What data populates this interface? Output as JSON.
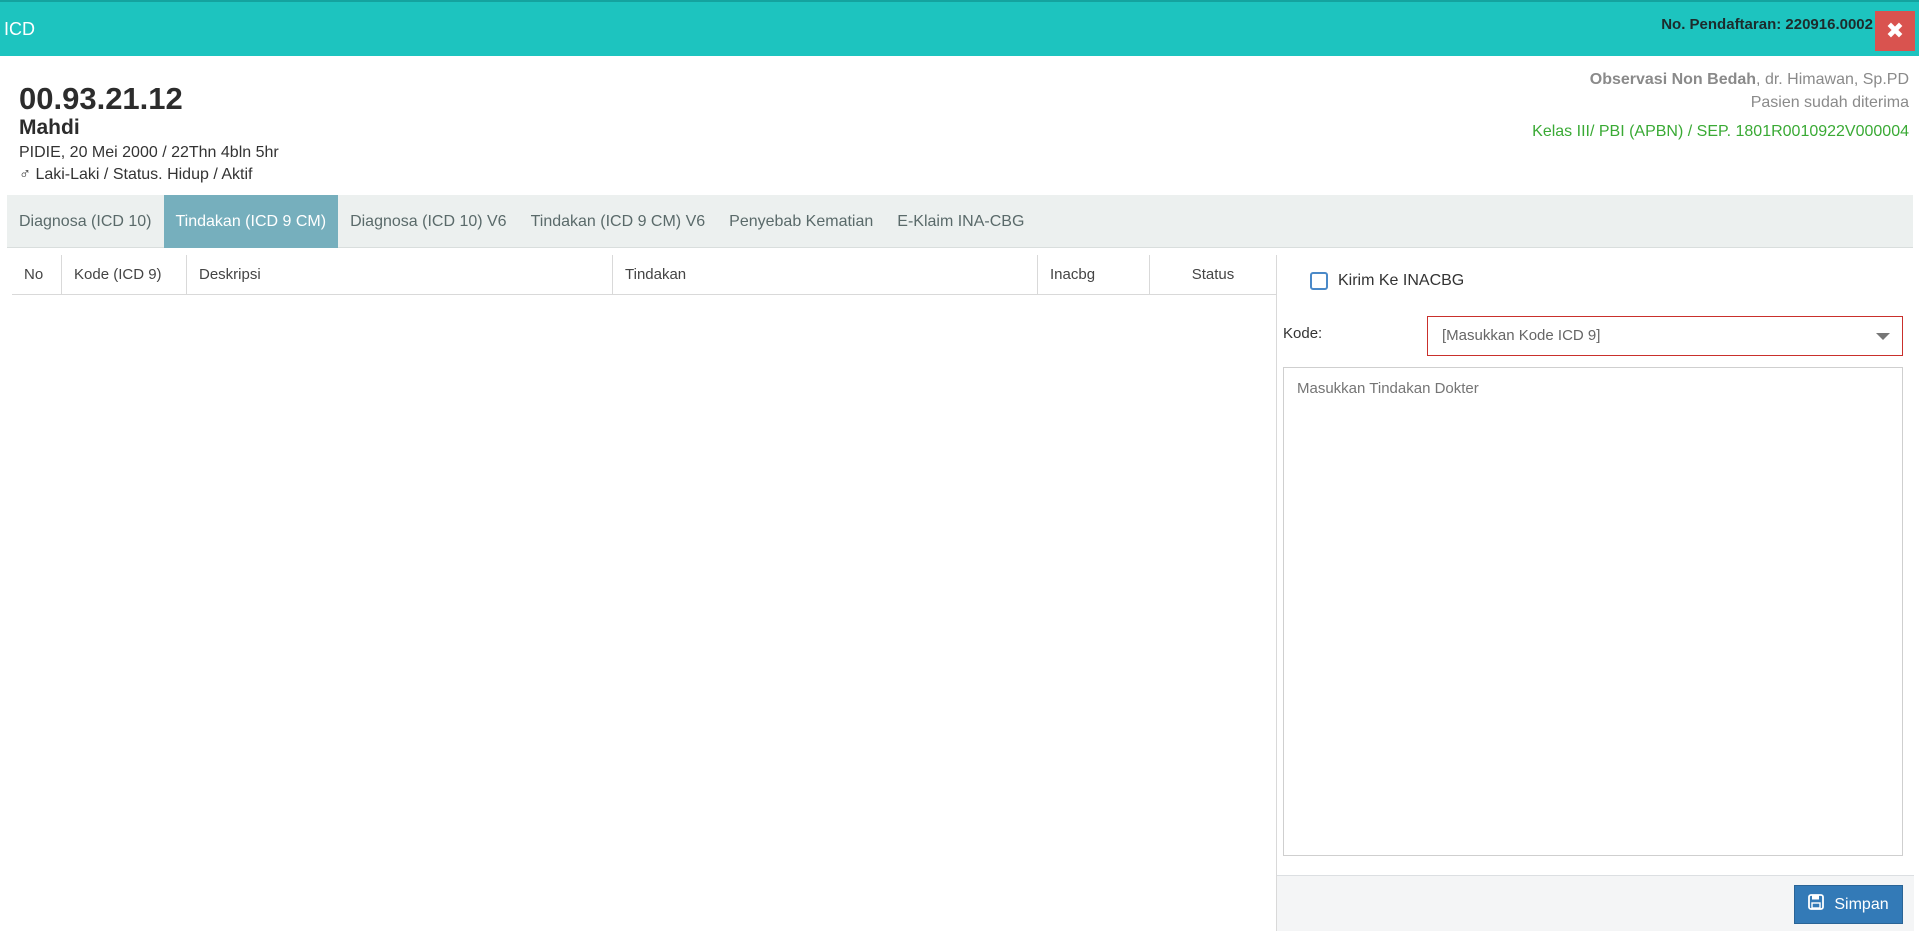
{
  "window": {
    "title": "ICD",
    "registration": "No. Pendaftaran: 220916.0002",
    "close_icon": "close-icon"
  },
  "patient": {
    "rm_number": "00.93.21.12",
    "name": "Mahdi",
    "birth": "PIDIE, 20 Mei 2000 / 22Thn 4bln 5hr",
    "sex_symbol": "♂",
    "sex_status": "Laki-Laki / Status. Hidup / Aktif"
  },
  "visit": {
    "unit": "Observasi Non Bedah",
    "doctor": ", dr. Himawan, Sp.PD",
    "status": "Pasien sudah diterima",
    "class_sep": "Kelas III/ PBI (APBN) / SEP. 1801R0010922V000004"
  },
  "tabs": [
    {
      "label": "Diagnosa (ICD 10)"
    },
    {
      "label": "Tindakan (ICD 9 CM)",
      "active": true
    },
    {
      "label": "Diagnosa (ICD 10) V6"
    },
    {
      "label": "Tindakan (ICD 9 CM) V6"
    },
    {
      "label": "Penyebab Kematian"
    },
    {
      "label": "E-Klaim INA-CBG"
    }
  ],
  "table": {
    "columns": [
      "No",
      "Kode (ICD 9)",
      "Deskripsi",
      "Tindakan",
      "Inacbg",
      "Status"
    ],
    "rows": []
  },
  "form": {
    "send_inacbg_label": "Kirim Ke INACBG",
    "send_inacbg_checked": false,
    "kode_label": "Kode:",
    "kode_placeholder": "[Masukkan Kode ICD 9]",
    "tindakan_placeholder": "Masukkan Tindakan Dokter",
    "save_label": "Simpan",
    "save_icon": "save-icon"
  },
  "colors": {
    "titlebar": "#1dc4bf",
    "close": "#d9534f",
    "active_tab": "#76afbd",
    "sep_text": "#3aaa35",
    "primary_button": "#337ab7"
  }
}
